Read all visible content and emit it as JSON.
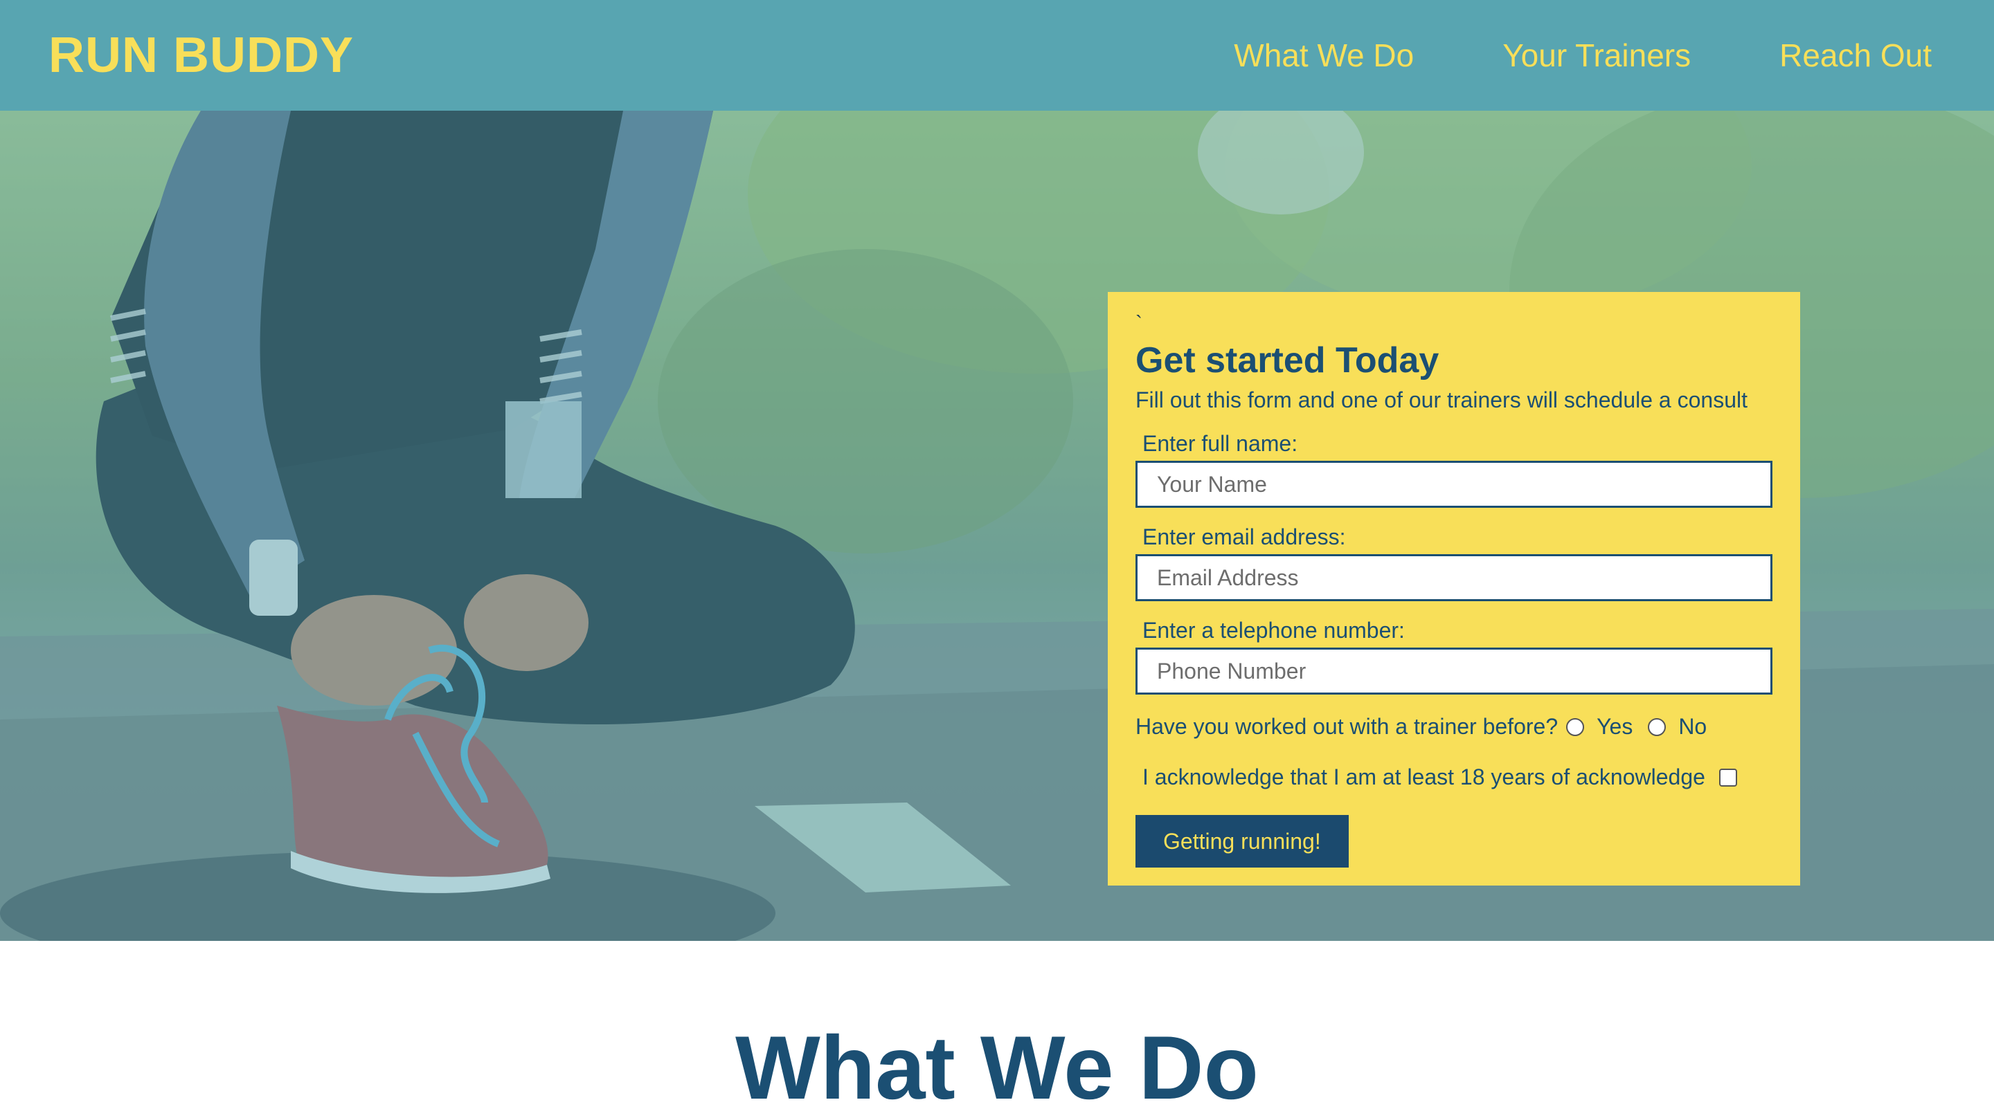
{
  "header": {
    "brand": "RUN BUDDY",
    "nav": [
      "What We Do",
      "Your Trainers",
      "Reach Out"
    ]
  },
  "hero": {
    "image_subject": "runner tying shoelace on road",
    "overlay_color": "#58a5b1"
  },
  "form": {
    "stray_char": "`",
    "title": "Get started Today",
    "subtitle": "Fill out this form and one of our trainers will schedule a consult",
    "name_label": "Enter full name:",
    "name_placeholder": "Your Name",
    "email_label": "Enter email address:",
    "email_placeholder": "Email Address",
    "phone_label": "Enter a telephone number:",
    "phone_placeholder": "Phone Number",
    "trainer_question": "Have you worked out with a trainer before?",
    "option_yes": "Yes",
    "option_no": "No",
    "acknowledge": "I acknowledge that I am at least 18 years of acknowledge",
    "submit": "Getting running!"
  },
  "section": {
    "title": "What We Do"
  },
  "colors": {
    "header_bg": "#58a5b1",
    "accent_yellow": "#f8df59",
    "navy": "#1b4a6e"
  }
}
